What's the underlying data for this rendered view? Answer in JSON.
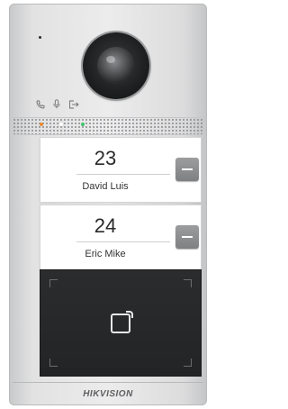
{
  "device": {
    "colors": {
      "led_orange": "#f08a2e",
      "led_white": "#ffffff",
      "led_green": "#3ec46d",
      "call_key": "#8c8d8f",
      "reader_panel": "#262729"
    },
    "status_icons": [
      "phone-icon",
      "microphone-icon",
      "door-exit-icon"
    ],
    "camera_icon": "camera-lens-icon",
    "card_reader_icon": "card-swipe-icon"
  },
  "buttons": [
    {
      "room": "23",
      "name": "David Luis"
    },
    {
      "room": "24",
      "name": "Eric Mike"
    }
  ],
  "brand": "HIKVISION"
}
